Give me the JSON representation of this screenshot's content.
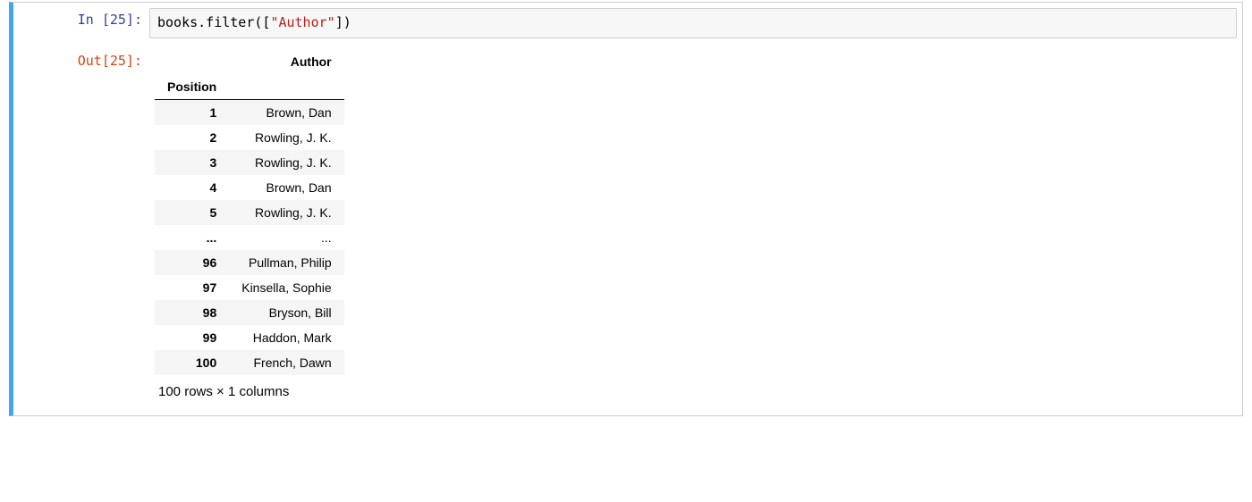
{
  "cell": {
    "in_label": "In [25]:",
    "out_label": "Out[25]:",
    "code": {
      "pre": "books.filter([",
      "str": "\"Author\"",
      "post": "])"
    }
  },
  "dataframe": {
    "col_header": "Author",
    "index_name": "Position",
    "rows": [
      {
        "idx": "1",
        "val": "Brown, Dan"
      },
      {
        "idx": "2",
        "val": "Rowling, J. K."
      },
      {
        "idx": "3",
        "val": "Rowling, J. K."
      },
      {
        "idx": "4",
        "val": "Brown, Dan"
      },
      {
        "idx": "5",
        "val": "Rowling, J. K."
      },
      {
        "idx": "...",
        "val": "..."
      },
      {
        "idx": "96",
        "val": "Pullman, Philip"
      },
      {
        "idx": "97",
        "val": "Kinsella, Sophie"
      },
      {
        "idx": "98",
        "val": "Bryson, Bill"
      },
      {
        "idx": "99",
        "val": "Haddon, Mark"
      },
      {
        "idx": "100",
        "val": "French, Dawn"
      }
    ],
    "summary": "100 rows × 1 columns"
  }
}
